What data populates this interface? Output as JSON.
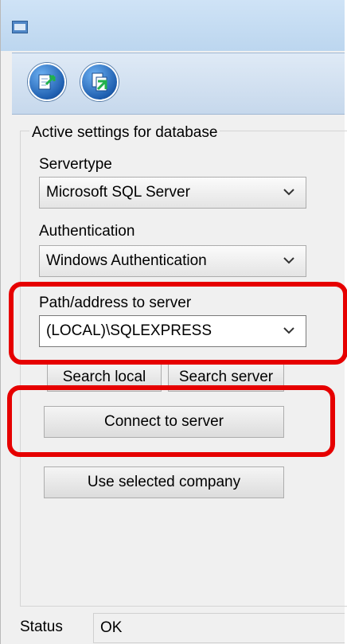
{
  "toolbar": {
    "buttons": [
      {
        "icon": "export-document-icon"
      },
      {
        "icon": "refresh-document-icon"
      }
    ]
  },
  "group": {
    "title": "Active settings for database"
  },
  "servertype": {
    "label": "Servertype",
    "value": "Microsoft SQL Server"
  },
  "authentication": {
    "label": "Authentication",
    "value": "Windows Authentication"
  },
  "server_path": {
    "label": "Path/address to server",
    "value": "(LOCAL)\\SQLEXPRESS"
  },
  "buttons": {
    "search_local": "Search local",
    "search_server": "Search server",
    "connect": "Connect to server",
    "use_company": "Use selected company"
  },
  "status": {
    "label": "Status",
    "value": "OK"
  },
  "colors": {
    "highlight": "#e60000",
    "toolbar_accent": "#1f5fb0"
  }
}
